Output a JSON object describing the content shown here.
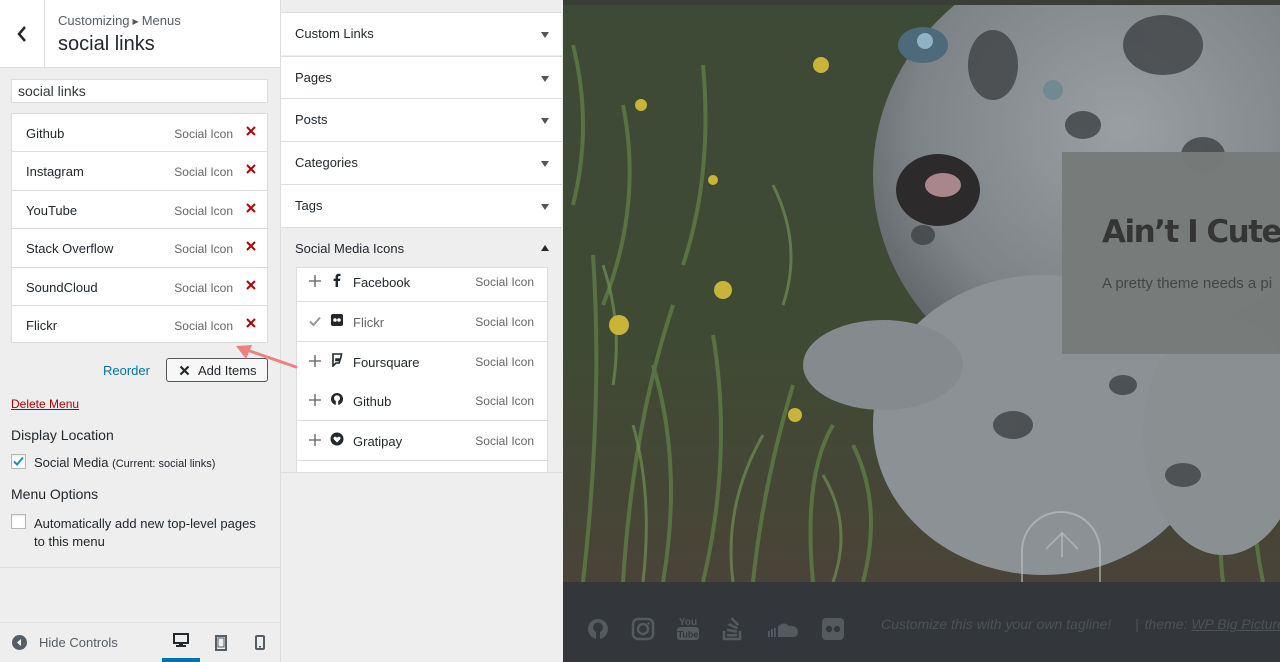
{
  "header": {
    "breadcrumb_root": "Customizing",
    "breadcrumb_section": "Menus",
    "title": "social links"
  },
  "menu": {
    "name_value": "social links",
    "items": [
      {
        "title": "Github",
        "type": "Social Icon"
      },
      {
        "title": "Instagram",
        "type": "Social Icon"
      },
      {
        "title": "YouTube",
        "type": "Social Icon"
      },
      {
        "title": "Stack Overflow",
        "type": "Social Icon"
      },
      {
        "title": "SoundCloud",
        "type": "Social Icon"
      },
      {
        "title": "Flickr",
        "type": "Social Icon"
      }
    ],
    "reorder_label": "Reorder",
    "add_items_label": "Add Items",
    "delete_label": "Delete Menu"
  },
  "display_location": {
    "heading": "Display Location",
    "option_label": "Social Media",
    "option_current": "(Current: social links)",
    "checked": true
  },
  "menu_options": {
    "heading": "Menu Options",
    "auto_add_label_line1": "Automatically add new top-level pages",
    "auto_add_label_line2": "to this menu",
    "checked": false
  },
  "footer_controls": {
    "hide_label": "Hide Controls",
    "devices": [
      "desktop",
      "tablet",
      "mobile"
    ],
    "active_device": "desktop"
  },
  "add_panel": {
    "sections": [
      {
        "label": "Custom Links",
        "open": false
      },
      {
        "label": "Pages",
        "open": false
      },
      {
        "label": "Posts",
        "open": false
      },
      {
        "label": "Categories",
        "open": false
      },
      {
        "label": "Tags",
        "open": false
      },
      {
        "label": "Social Media Icons",
        "open": true
      }
    ],
    "available": [
      {
        "title": "Facebook",
        "type": "Social Icon",
        "added": false,
        "icon": "facebook-icon"
      },
      {
        "title": "Flickr",
        "type": "Social Icon",
        "added": true,
        "icon": "flickr-icon"
      },
      {
        "title": "Foursquare",
        "type": "Social Icon",
        "added": false,
        "icon": "foursquare-icon"
      },
      {
        "title": "Github",
        "type": "Social Icon",
        "added": false,
        "icon": "github-icon"
      },
      {
        "title": "Gratipay",
        "type": "Social Icon",
        "added": false,
        "icon": "gratipay-icon"
      }
    ]
  },
  "preview": {
    "hero_title": "Ain’t I Cute?",
    "hero_subtitle": "A pretty theme needs a pi",
    "tagline": "Customize this with your own tagline!",
    "theme_prefix": "theme: ",
    "theme_link": "WP Big Picture",
    "footer_icons": [
      "github-icon",
      "instagram-icon",
      "youtube-icon",
      "stack-overflow-icon",
      "soundcloud-icon",
      "flickr-icon"
    ]
  },
  "colors": {
    "accent": "#0073aa",
    "delete": "#a00",
    "annotation_arrow": "#f08080"
  }
}
